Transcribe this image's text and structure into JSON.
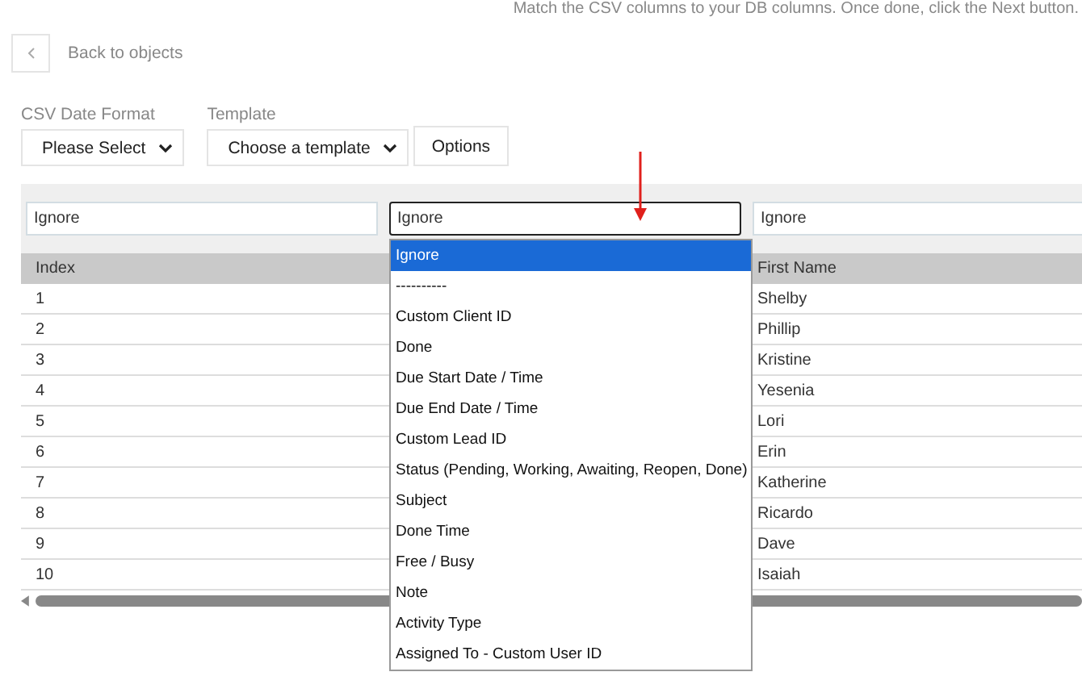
{
  "header_note": "Match the CSV columns to your DB columns. Once done, click the Next button.",
  "back_link": "Back to objects",
  "date_format": {
    "label": "CSV Date Format",
    "value": "Please Select"
  },
  "template": {
    "label": "Template",
    "value": "Choose a template"
  },
  "options_button": "Options",
  "mappings": [
    {
      "value": "Ignore",
      "focused": false
    },
    {
      "value": "Ignore",
      "focused": true
    },
    {
      "value": "Ignore",
      "focused": false
    }
  ],
  "table": {
    "columns": [
      "Index",
      "First Name"
    ],
    "rows": [
      {
        "index": "1",
        "first_name": "Shelby"
      },
      {
        "index": "2",
        "first_name": "Phillip"
      },
      {
        "index": "3",
        "first_name": "Kristine"
      },
      {
        "index": "4",
        "first_name": "Yesenia"
      },
      {
        "index": "5",
        "first_name": "Lori"
      },
      {
        "index": "6",
        "first_name": "Erin"
      },
      {
        "index": "7",
        "first_name": "Katherine"
      },
      {
        "index": "8",
        "first_name": "Ricardo"
      },
      {
        "index": "9",
        "first_name": "Dave"
      },
      {
        "index": "10",
        "first_name": "Isaiah"
      }
    ]
  },
  "dropdown": {
    "options": [
      {
        "label": "Ignore",
        "selected": true
      },
      {
        "label": "----------",
        "selected": false
      },
      {
        "label": "Custom Client ID",
        "selected": false
      },
      {
        "label": "Done",
        "selected": false
      },
      {
        "label": "Due Start Date / Time",
        "selected": false
      },
      {
        "label": "Due End Date / Time",
        "selected": false
      },
      {
        "label": "Custom Lead ID",
        "selected": false
      },
      {
        "label": "Status (Pending, Working, Awaiting, Reopen, Done)",
        "selected": false
      },
      {
        "label": "Subject",
        "selected": false
      },
      {
        "label": "Done Time",
        "selected": false
      },
      {
        "label": "Free / Busy",
        "selected": false
      },
      {
        "label": "Note",
        "selected": false
      },
      {
        "label": "Activity Type",
        "selected": false
      },
      {
        "label": "Assigned To - Custom User ID",
        "selected": false
      }
    ]
  }
}
